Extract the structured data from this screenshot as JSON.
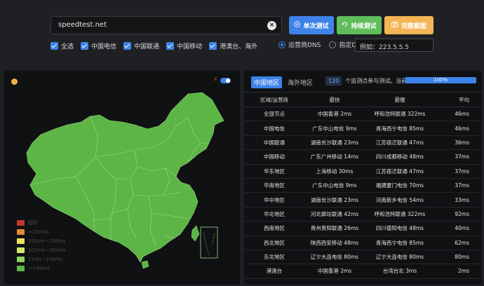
{
  "search": {
    "value": "speedtest.net"
  },
  "buttons": {
    "single": "单次测试",
    "continuous": "持续测试",
    "screenshot": "完整截图"
  },
  "filters": [
    "全选",
    "中国电信",
    "中国联通",
    "中国移动",
    "港澳台、海外"
  ],
  "dns": {
    "operator": "运营商DNS",
    "custom": "指定DNS:",
    "placeholder": "例如：223.5.5.5"
  },
  "colors": {
    "accent": "#3e83e8",
    "green": "#5fbd5a",
    "orange": "#f3b556",
    "map_fill": "#5cb545"
  },
  "map": {
    "legend": [
      {
        "label": "超时",
        "color": "#c0392b"
      },
      {
        "label": ">250ms",
        "color": "#e8893a"
      },
      {
        "label": "201ms~250ms",
        "color": "#f0e25a"
      },
      {
        "label": "101ms~200ms",
        "color": "#d4e96b"
      },
      {
        "label": "51ms~100ms",
        "color": "#8fd35e"
      },
      {
        "label": "<=50ms",
        "color": "#5cb545"
      }
    ]
  },
  "table": {
    "tabs": [
      "中国地区",
      "海外地区"
    ],
    "node_count": "120",
    "count_text": "个监测点参与测试。当前进度:",
    "progress": "100%",
    "headers": [
      "区域/运营商",
      "最快",
      "最慢",
      "平均"
    ],
    "rows": [
      [
        "全部节点",
        "中国香港 2ms",
        "呼和浩特联通 322ms",
        "46ms"
      ],
      [
        "中国电信",
        "广东中山电信 9ms",
        "青海西宁电信 85ms",
        "46ms"
      ],
      [
        "中国联通",
        "湖南长沙联通 23ms",
        "江苏宿迁联通 47ms",
        "36ms"
      ],
      [
        "中国移动",
        "广东广州移动 14ms",
        "四川成都移动 48ms",
        "37ms"
      ],
      [
        "华东地区",
        "上海移动 30ms",
        "江苏宿迁联通 47ms",
        "37ms"
      ],
      [
        "华南地区",
        "广东中山电信 9ms",
        "福建厦门电信 70ms",
        "37ms"
      ],
      [
        "华中地区",
        "湖南长沙联通 23ms",
        "河南新乡电信 54ms",
        "33ms"
      ],
      [
        "华北地区",
        "河北廊坊联通 42ms",
        "呼和浩特联通 322ms",
        "92ms"
      ],
      [
        "西南地区",
        "贵州贵阳联通 26ms",
        "四川德阳电信 48ms",
        "40ms"
      ],
      [
        "西北地区",
        "陕西西安移动 48ms",
        "青海西宁电信 85ms",
        "62ms"
      ],
      [
        "东北地区",
        "辽宁大连电信 80ms",
        "辽宁大连电信 80ms",
        "80ms"
      ],
      [
        "港澳台",
        "中国香港 2ms",
        "台湾台北 3ms",
        "2ms"
      ]
    ]
  }
}
